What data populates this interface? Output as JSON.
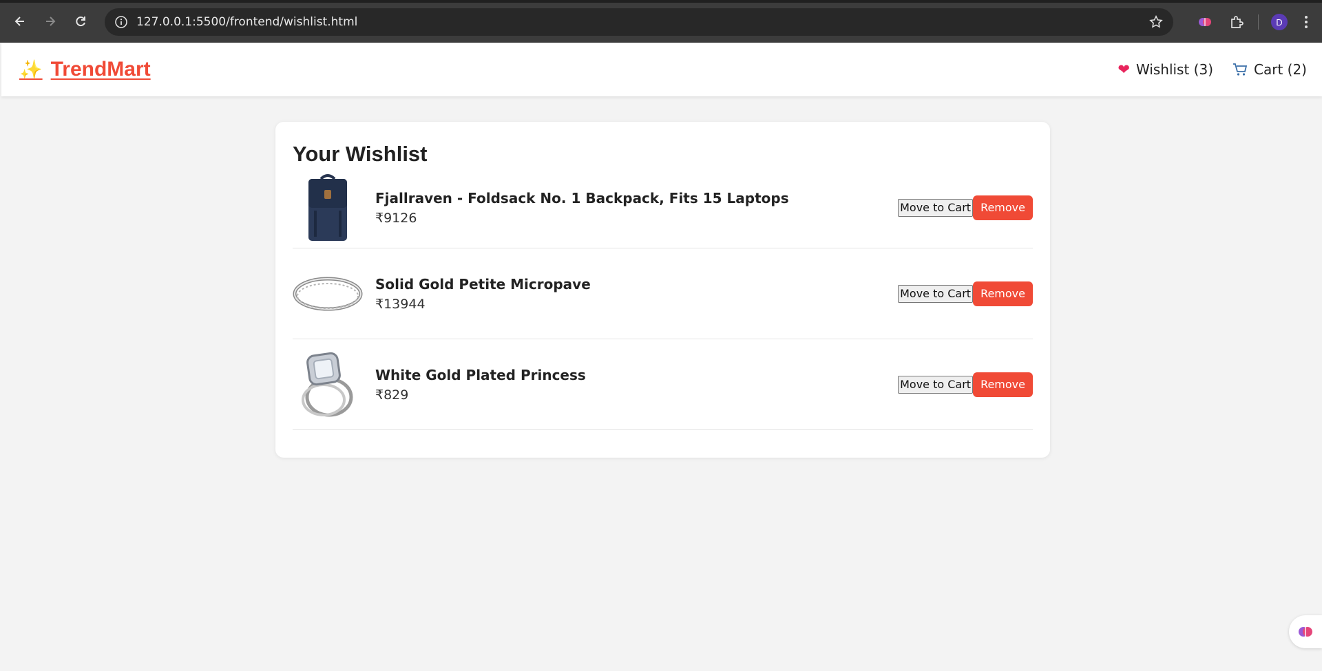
{
  "browser": {
    "url": "127.0.0.1:5500/frontend/wishlist.html",
    "profile_initial": "D"
  },
  "header": {
    "brand_icon": "sparkles-icon",
    "brand_name": "TrendMart",
    "wishlist_label": "Wishlist (3)",
    "cart_label": "Cart (2)",
    "accent_color": "#f04a36"
  },
  "wishlist": {
    "title": "Your Wishlist",
    "move_label": "Move to Cart",
    "remove_label": "Remove",
    "items": [
      {
        "name": "Fjallraven - Foldsack No. 1 Backpack, Fits 15 Laptops",
        "price": "₹9126",
        "image": "backpack"
      },
      {
        "name": "Solid Gold Petite Micropave",
        "price": "₹13944",
        "image": "silver-band-ring"
      },
      {
        "name": "White Gold Plated Princess",
        "price": "₹829",
        "image": "princess-cut-ring-set"
      }
    ]
  }
}
